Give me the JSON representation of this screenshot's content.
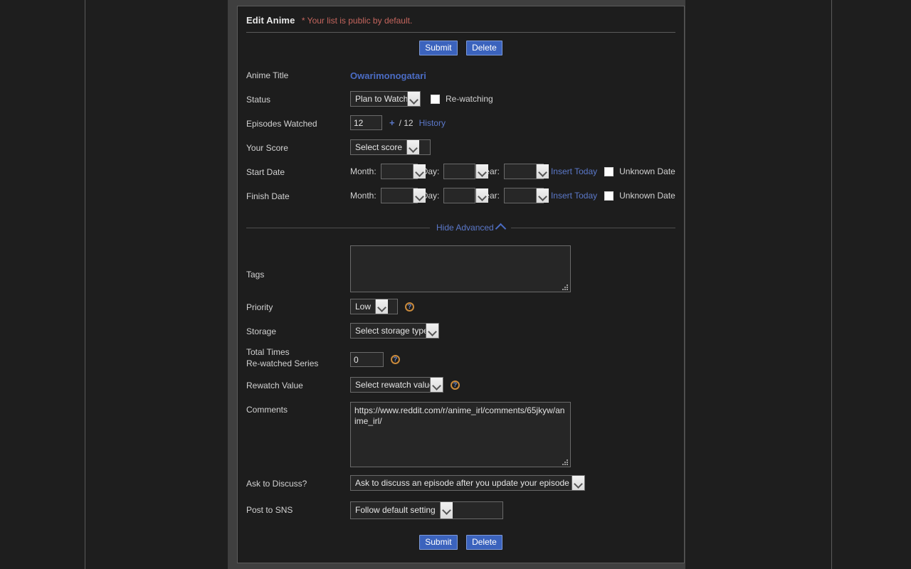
{
  "header": {
    "title": "Edit Anime",
    "note": "* Your list is public by default."
  },
  "buttons": {
    "submit": "Submit",
    "delete": "Delete"
  },
  "fields": {
    "anime_title": {
      "label": "Anime Title",
      "value": "Owarimonogatari"
    },
    "status": {
      "label": "Status",
      "value": "Plan to Watch",
      "rewatching_label": "Re-watching",
      "rewatching_checked": false
    },
    "episodes": {
      "label": "Episodes Watched",
      "value": "12",
      "plus": "+",
      "total": "/ 12",
      "history_link": "History"
    },
    "score": {
      "label": "Your Score",
      "value": "Select score"
    },
    "start_date": {
      "label": "Start Date",
      "month_label": "Month:",
      "month_value": "",
      "day_label": "Day:",
      "day_value": "",
      "year_label": "Year:",
      "year_value": "",
      "insert_today": "Insert Today",
      "unknown_label": "Unknown Date",
      "unknown_checked": false
    },
    "finish_date": {
      "label": "Finish Date",
      "month_label": "Month:",
      "month_value": "",
      "day_label": "Day:",
      "day_value": "",
      "year_label": "Year:",
      "year_value": "",
      "insert_today": "Insert Today",
      "unknown_label": "Unknown Date",
      "unknown_checked": false
    },
    "advanced_toggle": "Hide Advanced",
    "tags": {
      "label": "Tags",
      "value": ""
    },
    "priority": {
      "label": "Priority",
      "value": "Low",
      "help": "?"
    },
    "storage": {
      "label": "Storage",
      "value": "Select storage type"
    },
    "rewatched": {
      "label_line1": "Total Times",
      "label_line2": "Re-watched Series",
      "value": "0",
      "help": "?"
    },
    "rewatch_value": {
      "label": "Rewatch Value",
      "value": "Select rewatch value",
      "help": "?"
    },
    "comments": {
      "label": "Comments",
      "value": "https://www.reddit.com/r/anime_irl/comments/65jkyw/anime_irl/"
    },
    "ask_to_discuss": {
      "label": "Ask to Discuss?",
      "value": "Ask to discuss an episode after you update your episode count"
    },
    "post_to_sns": {
      "label": "Post to SNS",
      "value": "Follow default setting"
    }
  },
  "colors": {
    "accent_blue": "#4b6cc4",
    "button_blue": "#3b63bd",
    "note_red": "#c4655d",
    "panel_bg": "#1d1d1d",
    "page_bg": "#1e1e1e"
  }
}
